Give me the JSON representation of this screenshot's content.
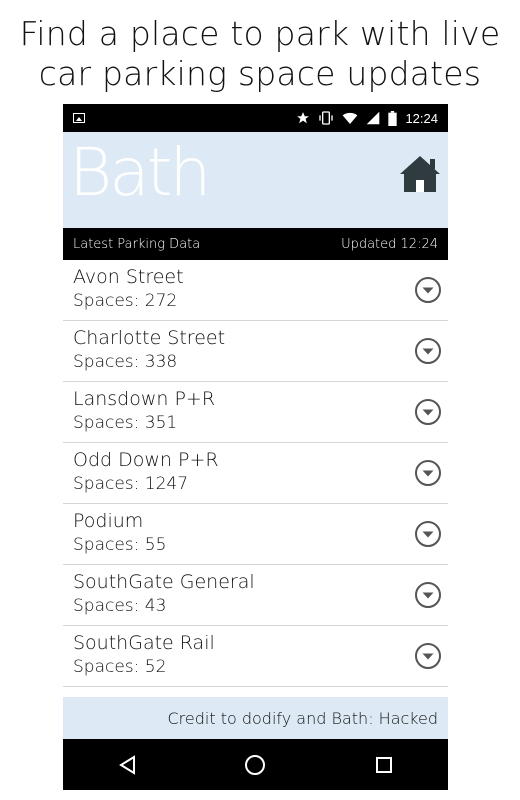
{
  "promo": {
    "line1": "Find a place to park with live",
    "line2": "car parking space updates"
  },
  "statusbar": {
    "time": "12:24",
    "icons": [
      "image-icon",
      "star-icon",
      "vibrate-icon",
      "wifi-icon",
      "signal-icon",
      "battery-icon"
    ]
  },
  "header": {
    "logo": "Bath",
    "home_icon": "home-icon"
  },
  "infobar": {
    "left": "Latest Parking Data",
    "right": "Updated 12:24"
  },
  "car_parks": [
    {
      "name": "Avon Street",
      "spaces": "Spaces: 272"
    },
    {
      "name": "Charlotte Street",
      "spaces": "Spaces: 338"
    },
    {
      "name": "Lansdown P+R",
      "spaces": "Spaces: 351"
    },
    {
      "name": "Odd Down P+R",
      "spaces": "Spaces: 1247"
    },
    {
      "name": "Podium",
      "spaces": "Spaces: 55"
    },
    {
      "name": "SouthGate General",
      "spaces": "Spaces: 43"
    },
    {
      "name": "SouthGate Rail",
      "spaces": "Spaces: 52"
    }
  ],
  "footer": {
    "credit": "Credit to dodify and Bath: Hacked"
  },
  "navbar": {
    "icons": [
      "back-icon",
      "home-circle-icon",
      "recents-icon"
    ]
  },
  "colors": {
    "header_bg": "#dde9f4",
    "bar_bg": "#000000",
    "chevron": "#555555"
  }
}
